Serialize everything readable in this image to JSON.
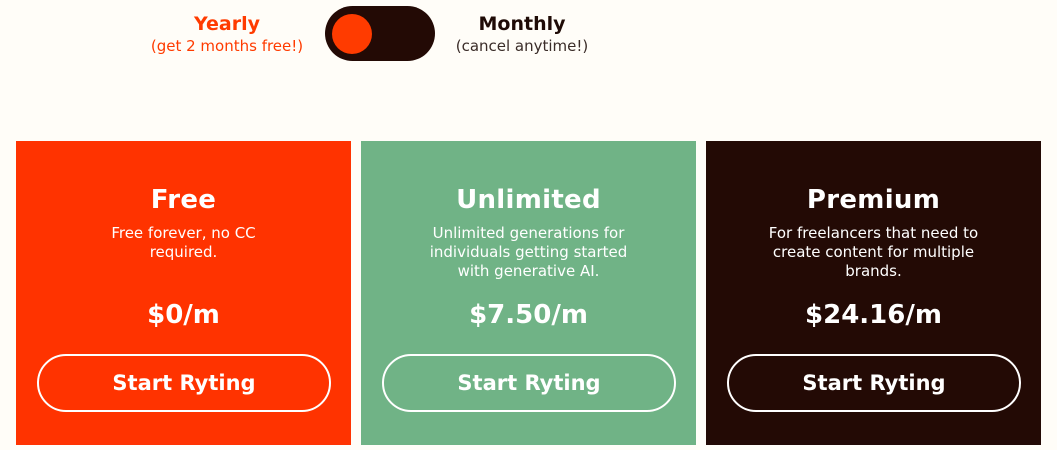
{
  "billing_toggle": {
    "yearly": {
      "label": "Yearly",
      "note": "(get 2 months free!)"
    },
    "monthly": {
      "label": "Monthly",
      "note": "(cancel anytime!)"
    },
    "selected": "Yearly",
    "knob_color": "#ff3b00",
    "track_color": "#230a05"
  },
  "plans": [
    {
      "name": "Free",
      "description": "Free forever, no CC required.",
      "price": "$0/m",
      "cta": "Start Ryting",
      "background": "#ff3300"
    },
    {
      "name": "Unlimited",
      "description": "Unlimited generations for individuals getting started with generative AI.",
      "price": "$7.50/m",
      "cta": "Start Ryting",
      "background": "#70b386"
    },
    {
      "name": "Premium",
      "description": "For freelancers that need to create content for multiple brands.",
      "price": "$24.16/m",
      "cta": "Start Ryting",
      "background": "#230a05"
    }
  ]
}
